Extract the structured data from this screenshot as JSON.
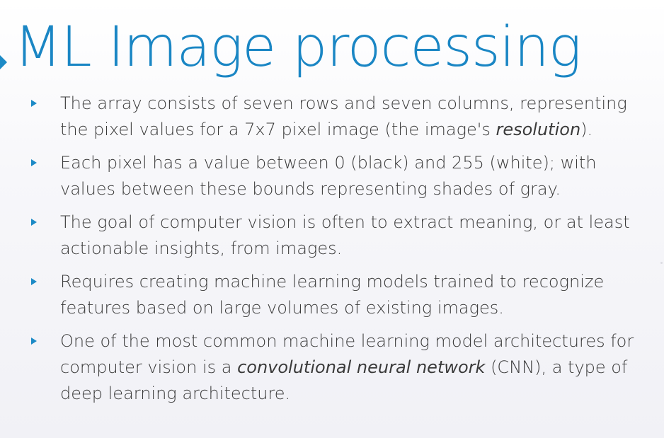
{
  "slide": {
    "title": "ML Image processing",
    "bullets": [
      {
        "segments": [
          "The array consists of seven rows and seven columns, representing the pixel values for a 7x7 pixel image (the image's ",
          "resolution",
          ")."
        ]
      },
      {
        "segments": [
          "Each pixel has a value between 0 (black) and 255 (white); with values between these bounds representing shades of gray."
        ]
      },
      {
        "segments": [
          "The goal of computer vision is often to extract meaning, or at least actionable insights, from images."
        ]
      },
      {
        "segments": [
          "Requires creating machine learning models trained to recognize features based on large volumes of existing images."
        ]
      },
      {
        "segments": [
          "One of the most common machine learning model architectures for computer vision is a ",
          "convolutional neural network",
          " (CNN), a type of deep learning architecture."
        ]
      }
    ]
  },
  "colors": {
    "accent": "#1a86c4",
    "text": "#3a3a3a"
  },
  "icons": {
    "title_marker": "triangle-right-icon",
    "bullet_marker": "triangle-right-icon"
  }
}
